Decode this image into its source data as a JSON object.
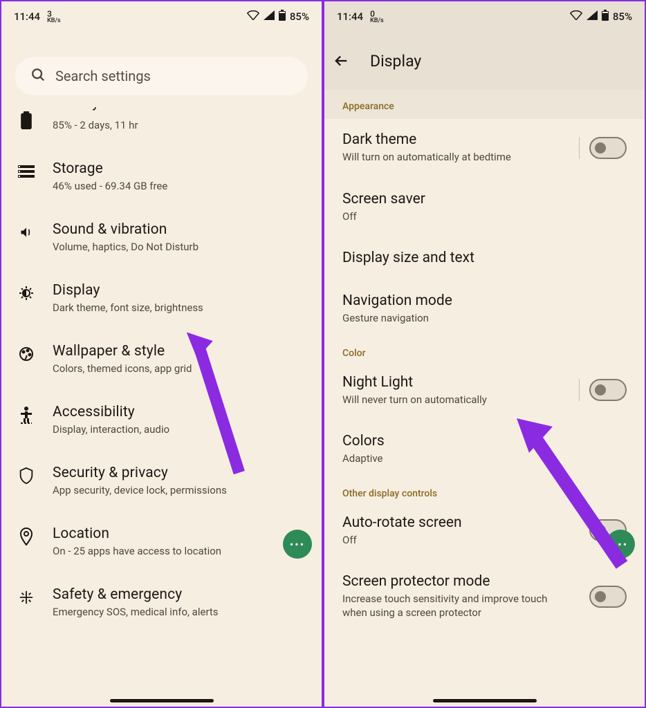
{
  "left": {
    "status": {
      "time": "11:44",
      "speed_num": "3",
      "speed_unit": "KB/s",
      "battery": "85%"
    },
    "search": {
      "placeholder": "Search settings"
    },
    "items": [
      {
        "title": "Battery",
        "sub": "85% - 2 days, 11 hr",
        "cut": true
      },
      {
        "title": "Storage",
        "sub": "46% used - 69.34 GB free"
      },
      {
        "title": "Sound & vibration",
        "sub": "Volume, haptics, Do Not Disturb"
      },
      {
        "title": "Display",
        "sub": "Dark theme, font size, brightness"
      },
      {
        "title": "Wallpaper & style",
        "sub": "Colors, themed icons, app grid"
      },
      {
        "title": "Accessibility",
        "sub": "Display, interaction, audio"
      },
      {
        "title": "Security & privacy",
        "sub": "App security, device lock, permissions"
      },
      {
        "title": "Location",
        "sub": "On - 25 apps have access to location"
      },
      {
        "title": "Safety & emergency",
        "sub": "Emergency SOS, medical info, alerts"
      }
    ]
  },
  "right": {
    "status": {
      "time": "11:44",
      "speed_num": "0",
      "speed_unit": "KB/s",
      "battery": "85%"
    },
    "title": "Display",
    "sections": [
      {
        "header": "Appearance",
        "items": [
          {
            "title": "Dark theme",
            "sub": "Will turn on automatically at bedtime",
            "toggle": true,
            "sep": true
          },
          {
            "title": "Screen saver",
            "sub": "Off"
          },
          {
            "title": "Display size and text",
            "sub": ""
          },
          {
            "title": "Navigation mode",
            "sub": "Gesture navigation"
          }
        ]
      },
      {
        "header": "Color",
        "items": [
          {
            "title": "Night Light",
            "sub": "Will never turn on automatically",
            "toggle": true,
            "sep": true
          },
          {
            "title": "Colors",
            "sub": "Adaptive"
          }
        ]
      },
      {
        "header": "Other display controls",
        "items": [
          {
            "title": "Auto-rotate screen",
            "sub": "Off",
            "toggle": true
          },
          {
            "title": "Screen protector mode",
            "sub": "Increase touch sensitivity and improve touch when using a screen protector",
            "toggle": true
          }
        ]
      }
    ]
  },
  "fab": "•••"
}
